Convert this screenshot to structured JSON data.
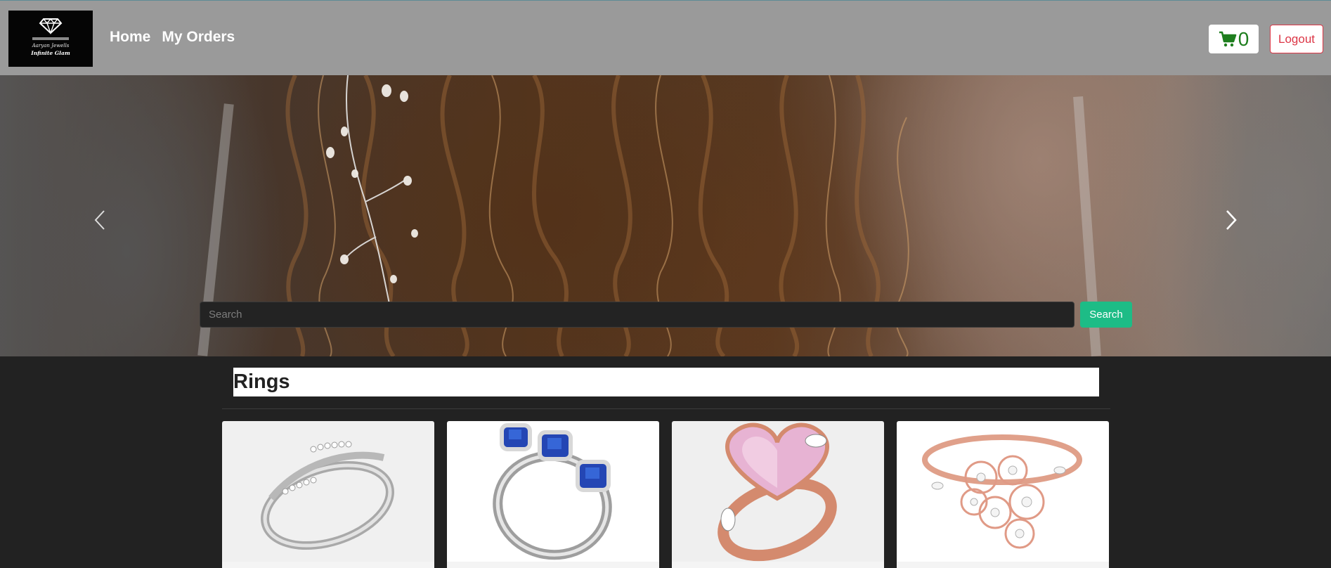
{
  "brand": {
    "name": "Aaryan Jewells",
    "tagline": "Infinite Glam"
  },
  "nav": {
    "home": "Home",
    "orders": "My Orders"
  },
  "cart": {
    "count": "0",
    "icon": "shopping-cart-icon",
    "color": "#1e7e1e"
  },
  "logout": {
    "label": "Logout",
    "color": "#dc3545"
  },
  "carousel": {
    "prev_icon": "chevron-left-icon",
    "next_icon": "chevron-right-icon"
  },
  "search": {
    "placeholder": "Search",
    "button_label": "Search",
    "button_color": "#1dbc86"
  },
  "catalog": {
    "section_title": "Rings",
    "products": [
      {
        "image": "silver-diamond-ring"
      },
      {
        "image": "blue-sapphire-ring"
      },
      {
        "image": "pink-heart-rose-gold-ring"
      },
      {
        "image": "rose-gold-floral-diamond-ring"
      }
    ]
  }
}
